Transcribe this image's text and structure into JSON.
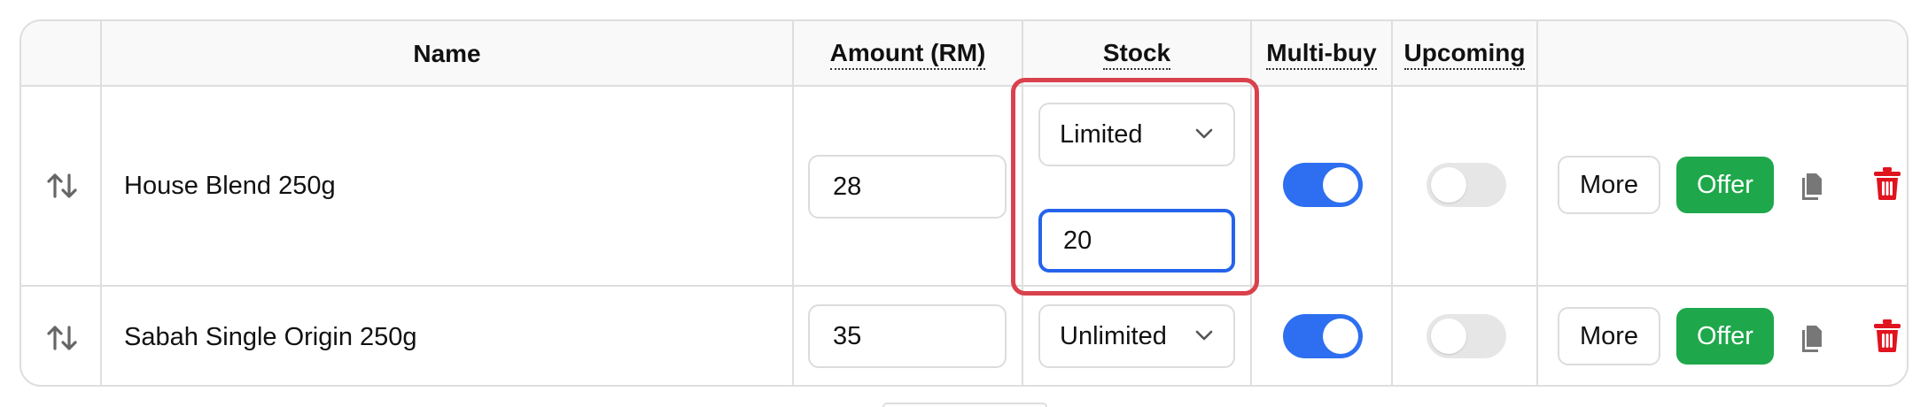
{
  "columns": {
    "name": "Name",
    "amount": "Amount (RM)",
    "stock": "Stock",
    "multi_buy": "Multi-buy",
    "upcoming": "Upcoming"
  },
  "rows": [
    {
      "name": "House Blend 250g",
      "amount": "28",
      "stock_mode": "Limited",
      "stock_qty": "20",
      "multi_buy": true,
      "upcoming": false,
      "more_label": "More",
      "offer_label": "Offer"
    },
    {
      "name": "Sabah Single Origin 250g",
      "amount": "35",
      "stock_mode": "Unlimited",
      "multi_buy": true,
      "upcoming": false,
      "more_label": "More",
      "offer_label": "Offer"
    }
  ],
  "colors": {
    "toggle_on": "#2d6ff0",
    "offer_button": "#1ea84b",
    "delete_icon": "#e0141e",
    "focus_ring": "#2563eb",
    "highlight": "#d9414c"
  },
  "icons": {
    "sort": "sort-arrows-icon",
    "chevron": "chevron-down-icon",
    "duplicate": "copy-icon",
    "delete": "trash-icon"
  }
}
